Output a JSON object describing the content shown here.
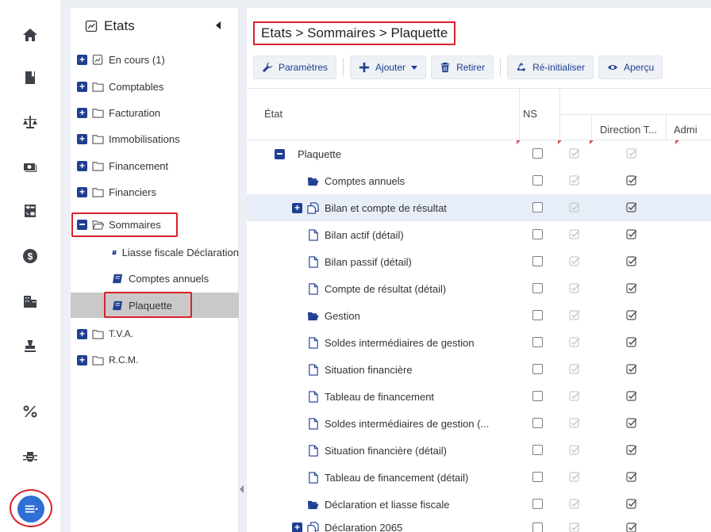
{
  "rail": {
    "icons": [
      "home-icon",
      "book-icon",
      "balance-scale-icon",
      "money-icon",
      "calculator-icon",
      "dollar-icon",
      "building-icon",
      "stamp-icon",
      "percent-icon",
      "bug-icon",
      "list-icon"
    ]
  },
  "tree": {
    "title": "Etats",
    "items": [
      {
        "label": "En cours (1)"
      },
      {
        "label": "Comptables"
      },
      {
        "label": "Facturation"
      },
      {
        "label": "Immobilisations"
      },
      {
        "label": "Financement"
      },
      {
        "label": "Financiers"
      },
      {
        "label": "Sommaires"
      },
      {
        "label": "Liasse fiscale Déclaration"
      },
      {
        "label": "Comptes annuels"
      },
      {
        "label": "Plaquette"
      },
      {
        "label": "T.V.A."
      },
      {
        "label": "R.C.M."
      }
    ]
  },
  "main": {
    "breadcrumb": "Etats > Sommaires > Plaquette",
    "toolbar": {
      "params": "Paramètres",
      "add": "Ajouter",
      "remove": "Retirer",
      "reset": "Ré-initialiser",
      "preview": "Aperçu"
    },
    "grid": {
      "col_etat": "État",
      "col_ns": "NS",
      "col_dir": "Direction T...",
      "col_adm": "Admi",
      "rows": [
        {
          "name": "Plaquette"
        },
        {
          "name": "Comptes annuels"
        },
        {
          "name": "Bilan et compte de résultat"
        },
        {
          "name": "Bilan actif (détail)"
        },
        {
          "name": "Bilan passif (détail)"
        },
        {
          "name": "Compte de résultat (détail)"
        },
        {
          "name": "Gestion"
        },
        {
          "name": "Soldes intermédiaires de gestion"
        },
        {
          "name": "Situation financière"
        },
        {
          "name": "Tableau de financement"
        },
        {
          "name": "Soldes intermédiaires de gestion (..."
        },
        {
          "name": "Situation financière (détail)"
        },
        {
          "name": "Tableau de financement (détail)"
        },
        {
          "name": "Déclaration et liasse fiscale"
        },
        {
          "name": "Déclaration 2065"
        }
      ]
    }
  }
}
